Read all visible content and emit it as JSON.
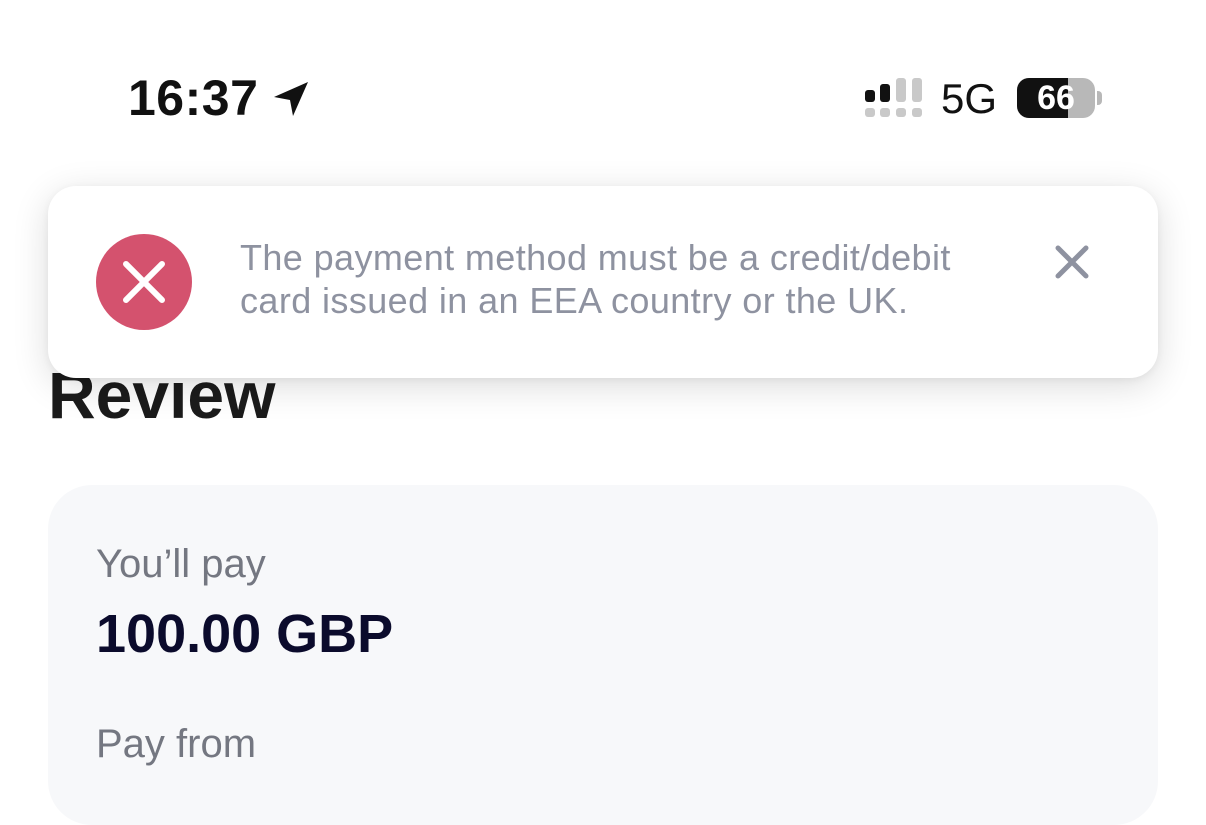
{
  "status_bar": {
    "time": "16:37",
    "network": "5G",
    "battery_level": "66",
    "battery_fraction": 0.66,
    "icons": [
      "location-arrow-icon",
      "signal-icon",
      "battery-icon"
    ]
  },
  "toast": {
    "message": "The payment method must be a credit/debit card issued in an EEA country or the UK.",
    "icon": "error-x-icon",
    "close_icon": "close-icon",
    "accent_color": "#d4526e"
  },
  "page": {
    "title": "Review"
  },
  "summary": {
    "pay_label": "You’ll pay",
    "pay_amount": "100.00 GBP",
    "pay_from_label": "Pay from"
  }
}
